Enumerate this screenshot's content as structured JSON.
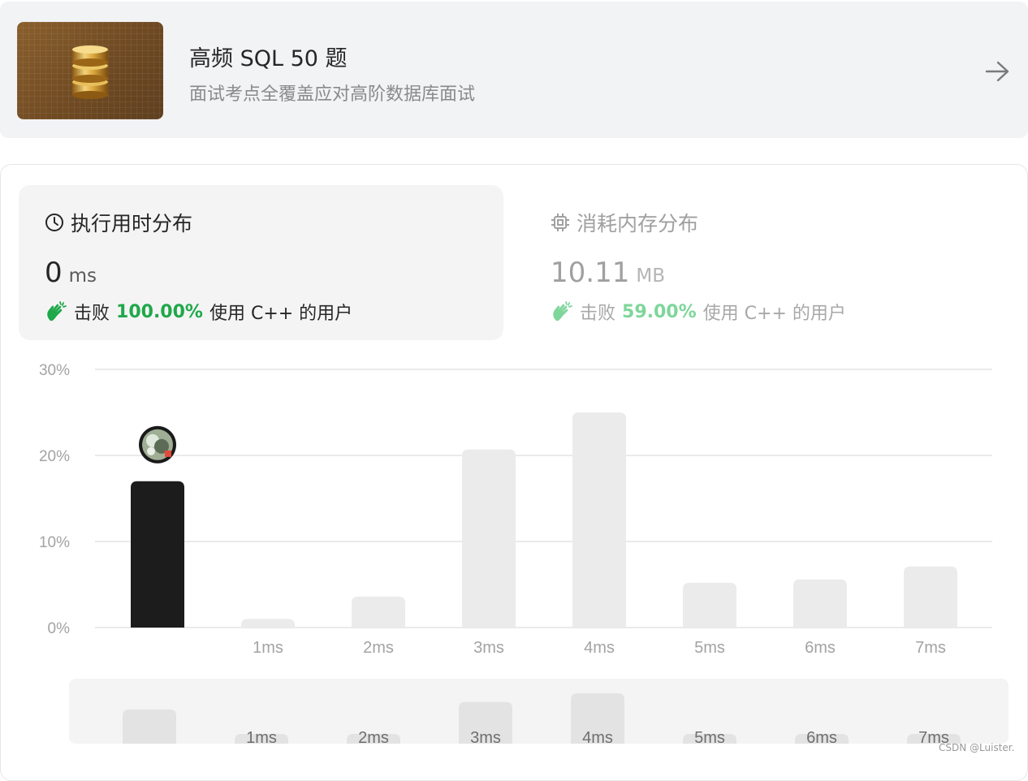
{
  "banner": {
    "title": "高频 SQL 50 题",
    "subtitle": "面试考点全覆盖应对高阶数据库面试",
    "thumbnail_icon": "database-icon",
    "arrow_icon": "arrow-right-icon"
  },
  "tabs": {
    "runtime": {
      "title": "执行用时分布",
      "icon": "clock-icon",
      "value": "0",
      "unit": "ms",
      "beat_prefix": "击败",
      "beat_percent": "100.00%",
      "beat_suffix": "使用 C++ 的用户",
      "selected": true
    },
    "memory": {
      "title": "消耗内存分布",
      "icon": "chip-icon",
      "value": "10.11",
      "unit": "MB",
      "beat_prefix": "击败",
      "beat_percent": "59.00%",
      "beat_suffix": "使用 C++ 的用户",
      "selected": false
    }
  },
  "colors": {
    "accent_green": "#1fa84a",
    "highlight_bar": "#1c1c1c",
    "bar": "#ebebeb",
    "grid": "#e4e4e4",
    "axis_text": "#a3a3a3"
  },
  "chart_data": {
    "type": "bar",
    "categories": [
      "",
      "1ms",
      "2ms",
      "3ms",
      "4ms",
      "5ms",
      "6ms",
      "7ms"
    ],
    "values": [
      17,
      1,
      3.6,
      20.7,
      25,
      5.2,
      5.6,
      7.1
    ],
    "highlight_index": 0,
    "yticks": [
      "0%",
      "10%",
      "20%",
      "30%"
    ],
    "ylim": [
      0,
      30
    ],
    "grid": true,
    "marker": "user-avatar-icon"
  },
  "overview": {
    "labels": [
      "",
      "1ms",
      "2ms",
      "3ms",
      "4ms",
      "5ms",
      "6ms",
      "7ms"
    ]
  },
  "watermark": "CSDN @Luister."
}
